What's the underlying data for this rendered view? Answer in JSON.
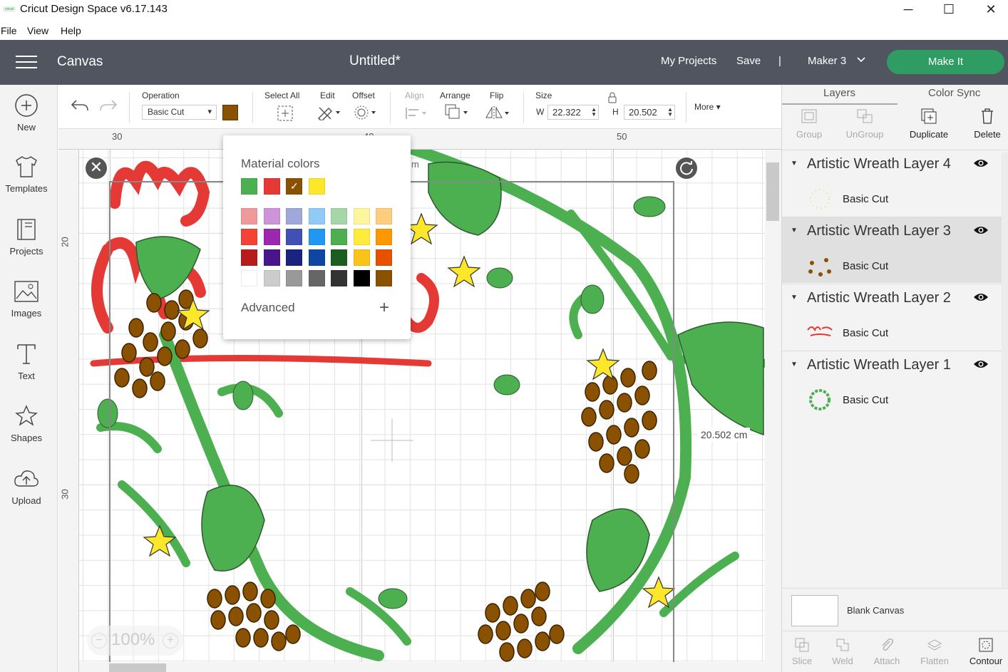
{
  "window": {
    "title": "Cricut Design Space  v6.17.143",
    "minimize": "─",
    "maximize": "☐",
    "close": "✕"
  },
  "menu": [
    "File",
    "View",
    "Help"
  ],
  "header": {
    "section": "Canvas",
    "doc_title": "Untitled*",
    "my_projects": "My Projects",
    "save": "Save",
    "separator": "|",
    "machine": "Maker 3",
    "make_it": "Make It"
  },
  "sidebar": [
    {
      "label": "New",
      "icon": "plus-circle-icon"
    },
    {
      "label": "Templates",
      "icon": "shirt-icon"
    },
    {
      "label": "Projects",
      "icon": "projects-icon"
    },
    {
      "label": "Images",
      "icon": "image-icon"
    },
    {
      "label": "Text",
      "icon": "text-icon"
    },
    {
      "label": "Shapes",
      "icon": "shapes-icon"
    },
    {
      "label": "Upload",
      "icon": "upload-icon"
    }
  ],
  "toolbar": {
    "operation_label": "Operation",
    "operation_value": "Basic Cut",
    "operation_color": "#8a5200",
    "select_all": "Select All",
    "edit": "Edit",
    "offset": "Offset",
    "align": "Align",
    "arrange": "Arrange",
    "flip": "Flip",
    "size_label": "Size",
    "w_label": "W",
    "w_value": "22.322",
    "h_label": "H",
    "h_value": "20.502",
    "more": "More"
  },
  "rulers": {
    "top": [
      "30",
      "40",
      "50"
    ],
    "left": [
      "20",
      "30"
    ]
  },
  "canvas": {
    "dimension_label": "20.502 cm",
    "zoom": "100%",
    "ruler_unit_fragment": "m"
  },
  "color_popup": {
    "title": "Material colors",
    "material": [
      "#4caf50",
      "#e53935",
      "#8a5200",
      "#fde72b"
    ],
    "selected_index": 2,
    "palette": [
      [
        "#ef9a9a",
        "#ce93d8",
        "#9fa8da",
        "#90caf9",
        "#a5d6a7",
        "#fff59d",
        "#ffcc80"
      ],
      [
        "#f44336",
        "#9c27b0",
        "#3f51b5",
        "#2196f3",
        "#4caf50",
        "#ffeb3b",
        "#ff9800"
      ],
      [
        "#b71c1c",
        "#4a148c",
        "#1a237e",
        "#0d47a1",
        "#1b5e20",
        "#f9c31a",
        "#e65100"
      ],
      [
        "#ffffff",
        "#cccccc",
        "#999999",
        "#666666",
        "#333333",
        "#000000",
        "#8a5200"
      ]
    ],
    "advanced": "Advanced"
  },
  "right_panel": {
    "tabs": [
      "Layers",
      "Color Sync"
    ],
    "actions": [
      "Group",
      "UnGroup",
      "Duplicate",
      "Delete"
    ],
    "layers": [
      {
        "name": "Artistic Wreath Layer 4",
        "op": "Basic Cut",
        "selected": false
      },
      {
        "name": "Artistic Wreath Layer 3",
        "op": "Basic Cut",
        "selected": true
      },
      {
        "name": "Artistic Wreath Layer 2",
        "op": "Basic Cut",
        "selected": false
      },
      {
        "name": "Artistic Wreath Layer 1",
        "op": "Basic Cut",
        "selected": false
      }
    ],
    "blank_canvas": "Blank Canvas",
    "bottom_actions": [
      "Slice",
      "Weld",
      "Attach",
      "Flatten",
      "Contour"
    ]
  }
}
